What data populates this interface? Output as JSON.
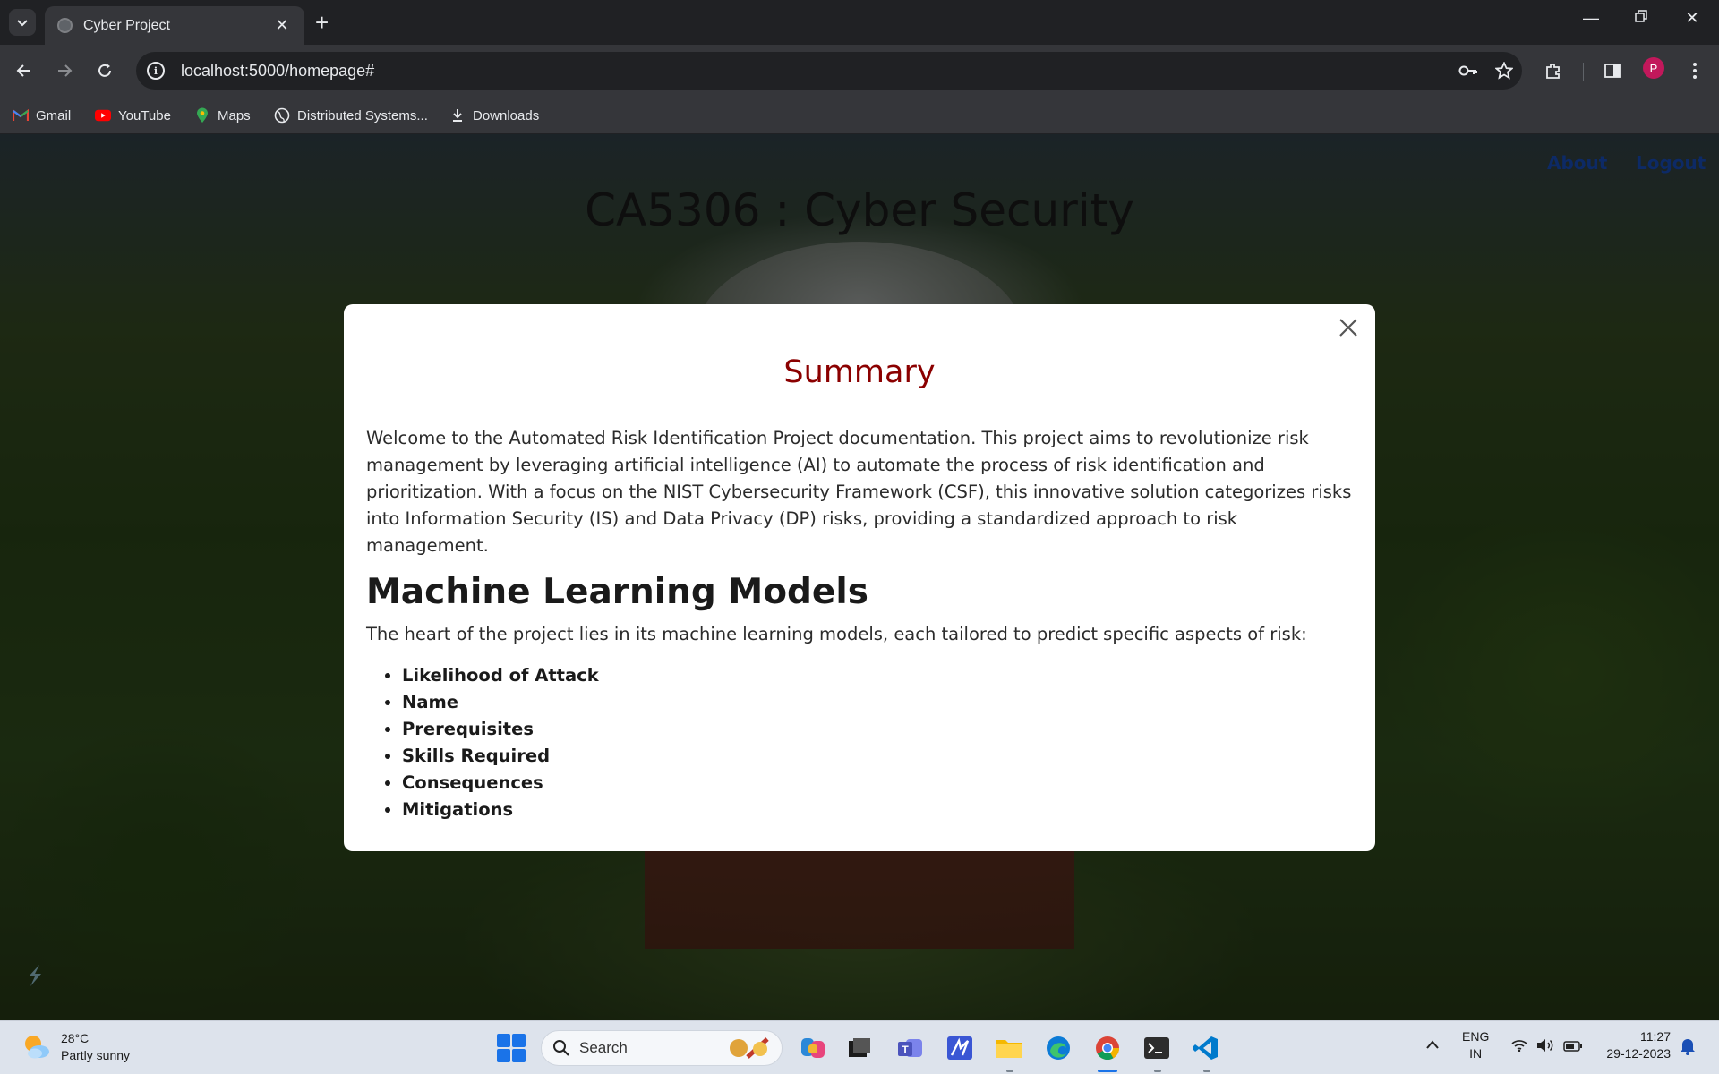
{
  "browser": {
    "tab_title": "Cyber Project",
    "url": "localhost:5000/homepage#",
    "bookmarks": [
      "Gmail",
      "YouTube",
      "Maps",
      "Distributed Systems...",
      "Downloads"
    ],
    "profile_initial": "P"
  },
  "page": {
    "title": "CA5306 : Cyber Security",
    "nav": {
      "about": "About",
      "logout": "Logout"
    }
  },
  "modal": {
    "title": "Summary",
    "intro": "Welcome to the Automated Risk Identification Project documentation. This project aims to revolutionize risk management by leveraging artificial intelligence (AI) to automate the process of risk identification and prioritization. With a focus on the NIST Cybersecurity Framework (CSF), this innovative solution categorizes risks into Information Security (IS) and Data Privacy (DP) risks, providing a standardized approach to risk management.",
    "section_heading": "Machine Learning Models",
    "section_text": "The heart of the project lies in its machine learning models, each tailored to predict specific aspects of risk:",
    "models": [
      "Likelihood of Attack",
      "Name",
      "Prerequisites",
      "Skills Required",
      "Consequences",
      "Mitigations"
    ]
  },
  "taskbar": {
    "weather_temp": "28°C",
    "weather_desc": "Partly sunny",
    "search_label": "Search",
    "lang_top": "ENG",
    "lang_bottom": "IN",
    "time": "11:27",
    "date": "29-12-2023"
  },
  "colors": {
    "modal_title": "#8b0000",
    "nav_link": "#0d2a66",
    "chrome_dark": "#202124",
    "chrome_toolbar": "#35363a"
  }
}
